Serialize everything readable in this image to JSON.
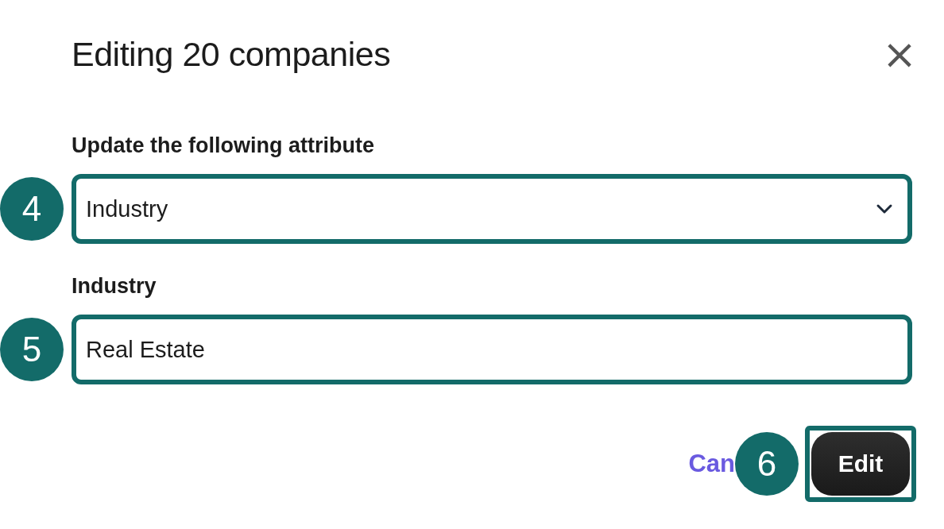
{
  "dialog": {
    "title": "Editing 20 companies",
    "close": "×"
  },
  "fields": [
    {
      "kind": "select",
      "label": "Update the following attribute",
      "value": "Industry",
      "highlighted": true,
      "step": "4"
    },
    {
      "kind": "text",
      "label": "Industry",
      "value": "Real Estate",
      "highlighted": true,
      "step": "5"
    }
  ],
  "footer": {
    "cancel": "Can",
    "edit": {
      "label": "Edit",
      "highlighted": true,
      "step": "6"
    }
  }
}
